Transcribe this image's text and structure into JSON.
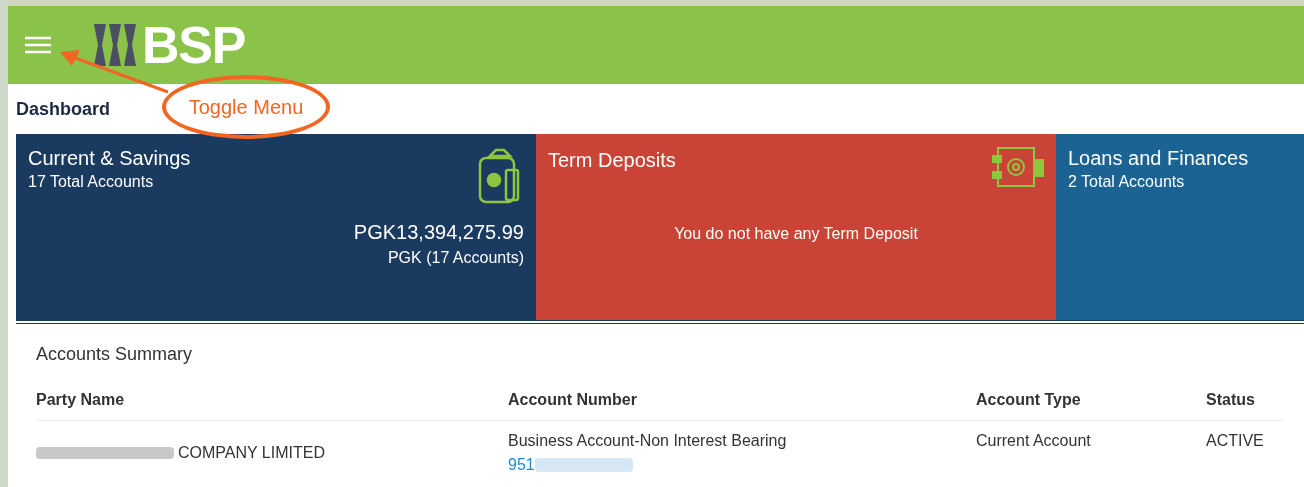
{
  "header": {
    "logo": "BSP"
  },
  "annotation": {
    "label": "Toggle Menu"
  },
  "page_title": "Dashboard",
  "cards": [
    {
      "kind": "accounts",
      "title": "Current & Savings",
      "subtitle": "17 Total Accounts",
      "amount": "PGK13,394,275.99",
      "amount_note": "PGK (17 Accounts)",
      "color": "#1b3a5f"
    },
    {
      "kind": "empty",
      "title": "Term Deposits",
      "message": "You do not have any Term Deposit",
      "color": "#c94436"
    },
    {
      "kind": "loans",
      "title": "Loans and Finances",
      "subtitle": "2 Total Accounts",
      "color": "#1a6393"
    }
  ],
  "summary": {
    "title": "Accounts Summary",
    "columns": [
      "Party Name",
      "Account Number",
      "Account Type",
      "Status"
    ],
    "rows": [
      {
        "party": "COMPANY LIMITED",
        "account_desc": "Business Account-Non Interest Bearing",
        "account_number": "951",
        "account_type": "Current Account",
        "status": "ACTIVE"
      }
    ]
  }
}
